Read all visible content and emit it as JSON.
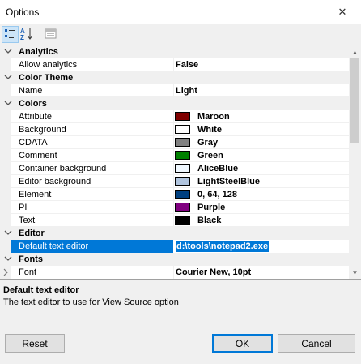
{
  "window": {
    "title": "Options",
    "close_label": "✕"
  },
  "toolbar": {
    "categorized_icon": "categorized-view-icon",
    "alpha_icon": "alphabetical-sort-icon",
    "pages_icon": "property-pages-icon",
    "alpha_glyph": "A↓Z"
  },
  "categories": {
    "analytics": "Analytics",
    "color_theme": "Color Theme",
    "colors": "Colors",
    "editor": "Editor",
    "fonts": "Fonts"
  },
  "properties": {
    "allow_analytics": {
      "name": "Allow analytics",
      "value": "False"
    },
    "theme_name": {
      "name": "Name",
      "value": "Light"
    },
    "attribute": {
      "name": "Attribute",
      "value": "Maroon",
      "color": "#800000"
    },
    "background": {
      "name": "Background",
      "value": "White",
      "color": "#ffffff"
    },
    "cdata": {
      "name": "CDATA",
      "value": "Gray",
      "color": "#808080"
    },
    "comment": {
      "name": "Comment",
      "value": "Green",
      "color": "#008000"
    },
    "container_background": {
      "name": "Container background",
      "value": "AliceBlue",
      "color": "#f0f8ff"
    },
    "editor_background": {
      "name": "Editor background",
      "value": "LightSteelBlue",
      "color": "#b0c4de"
    },
    "element": {
      "name": "Element",
      "value": "0, 64, 128",
      "color": "#004080"
    },
    "pi": {
      "name": "PI",
      "value": "Purple",
      "color": "#800080"
    },
    "text": {
      "name": "Text",
      "value": "Black",
      "color": "#000000"
    },
    "default_text_editor": {
      "name": "Default text editor",
      "value": "d:\\tools\\notepad2.exe"
    },
    "font": {
      "name": "Font",
      "value": "Courier New, 10pt"
    }
  },
  "description": {
    "title": "Default text editor",
    "text": "The text editor to use for View Source option"
  },
  "buttons": {
    "reset": "Reset",
    "ok": "OK",
    "cancel": "Cancel"
  },
  "colors": {
    "selection": "#0078d7",
    "category_bg": "#f0f0f0"
  }
}
